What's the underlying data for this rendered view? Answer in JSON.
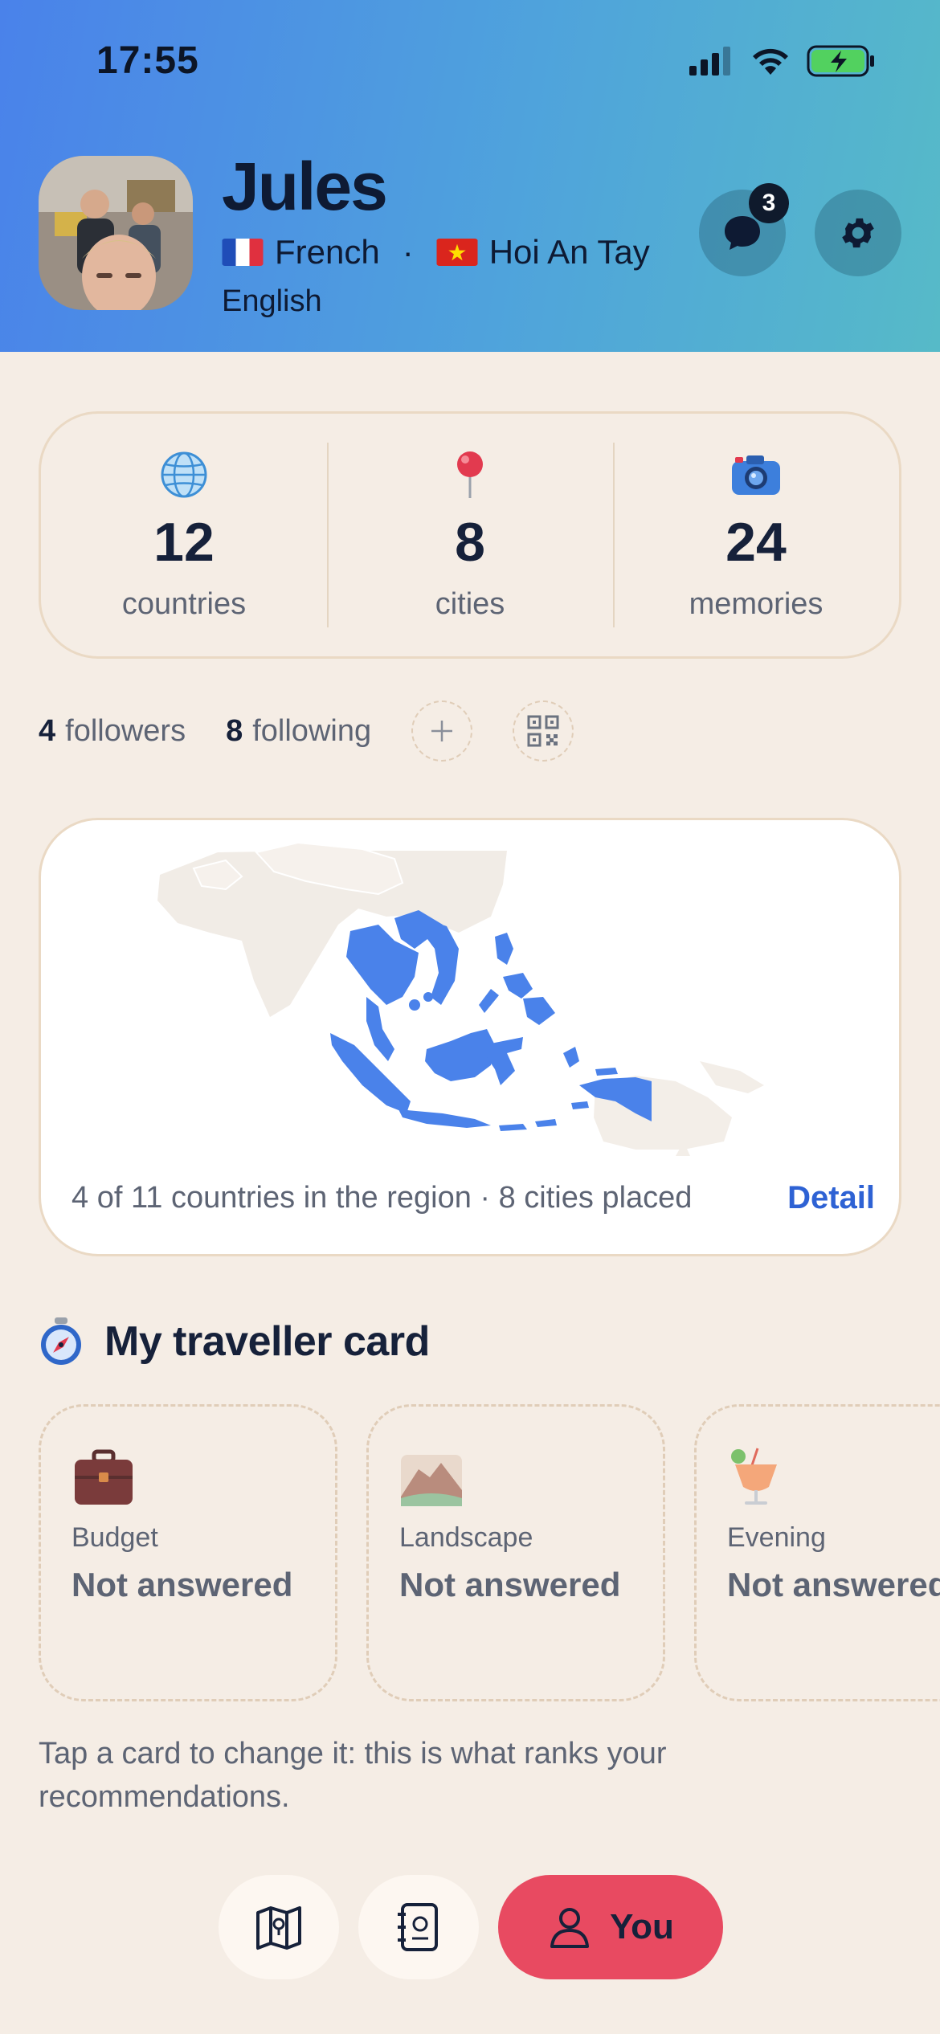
{
  "status_bar": {
    "time": "17:55"
  },
  "profile": {
    "name": "Jules",
    "native_language": {
      "flag": "france-flag",
      "label": "French"
    },
    "separator": "·",
    "home_city": {
      "flag": "vietnam-flag",
      "label": "Hoi An Tay"
    },
    "other_language": "English",
    "messages_badge": "3"
  },
  "stats": [
    {
      "icon": "globe-icon",
      "value": "12",
      "label": "countries"
    },
    {
      "icon": "pin-icon",
      "value": "8",
      "label": "cities"
    },
    {
      "icon": "camera-icon",
      "value": "24",
      "label": "memories"
    }
  ],
  "social": {
    "followers_count": "4",
    "followers_label": "followers",
    "following_count": "8",
    "following_label": "following"
  },
  "map": {
    "info": "4 of 11 countries in the region · 8 cities placed",
    "detail_label": "Detail",
    "highlight_color": "#4a82ea"
  },
  "traveller_card": {
    "title": "My traveller card",
    "cards": [
      {
        "icon": "briefcase-icon",
        "label": "Budget",
        "value": "Not answered"
      },
      {
        "icon": "mountain-icon",
        "label": "Landscape",
        "value": "Not answered"
      },
      {
        "icon": "cocktail-icon",
        "label": "Evening",
        "value": "Not answered"
      }
    ],
    "hint": "Tap a card to change it: this is what ranks your recommendations."
  },
  "nav": {
    "you_label": "You",
    "accent": "#e84a61"
  }
}
